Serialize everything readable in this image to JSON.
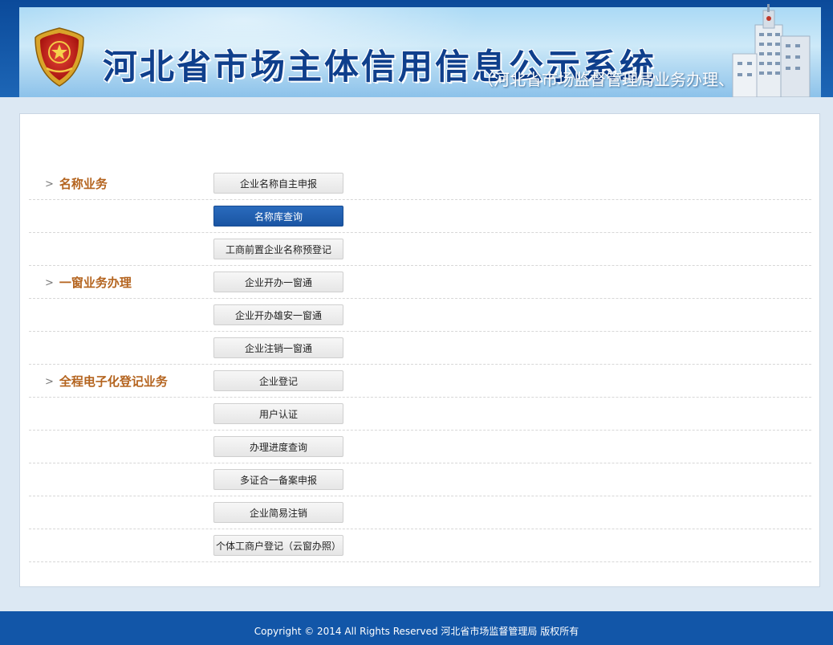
{
  "header": {
    "title": "河北省市场主体信用信息公示系统",
    "subtitle": "（河北省市场监督管理局业务办理、企业查询）"
  },
  "sections": [
    {
      "category": "名称业务",
      "items": [
        {
          "label": "企业名称自主申报",
          "active": false
        },
        {
          "label": "名称库查询",
          "active": true
        },
        {
          "label": "工商前置企业名称预登记",
          "active": false
        }
      ]
    },
    {
      "category": "一窗业务办理",
      "items": [
        {
          "label": "企业开办一窗通",
          "active": false
        },
        {
          "label": "企业开办雄安一窗通",
          "active": false
        },
        {
          "label": "企业注销一窗通",
          "active": false
        }
      ]
    },
    {
      "category": "全程电子化登记业务",
      "items": [
        {
          "label": "企业登记",
          "active": false
        },
        {
          "label": "用户认证",
          "active": false
        },
        {
          "label": "办理进度查询",
          "active": false
        },
        {
          "label": "多证合一备案申报",
          "active": false
        },
        {
          "label": "企业简易注销",
          "active": false
        },
        {
          "label": "个体工商户登记（云窗办照）",
          "active": false
        }
      ]
    }
  ],
  "footer": {
    "copyright": "Copyright © 2014 All Rights Reserved  河北省市场监督管理局  版权所有"
  },
  "colors": {
    "category_text": "#b4641f",
    "active_button": "#1f5fb0",
    "footer_bg": "#1256a8"
  }
}
